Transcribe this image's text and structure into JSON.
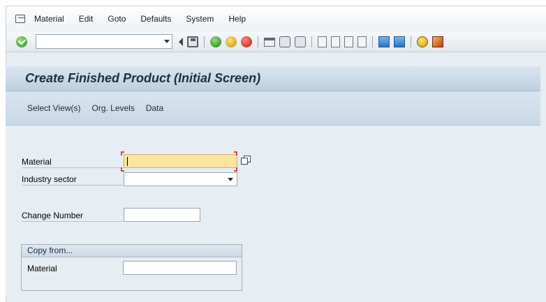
{
  "menubar": {
    "items": [
      {
        "label": "Material"
      },
      {
        "label": "Edit"
      },
      {
        "label": "Goto"
      },
      {
        "label": "Defaults"
      },
      {
        "label": "System"
      },
      {
        "label": "Help"
      }
    ]
  },
  "toolbar": {
    "command_value": "",
    "icons": [
      "enter-icon",
      "back-icon",
      "save-icon",
      "back-green-icon",
      "exit-icon",
      "cancel-icon",
      "print-icon",
      "find-icon",
      "find-next-icon",
      "first-page-icon",
      "previous-page-icon",
      "next-page-icon",
      "last-page-icon",
      "create-session-icon",
      "shortcut-icon",
      "help-icon",
      "layout-icon"
    ]
  },
  "screen": {
    "title": "Create Finished Product (Initial Screen)"
  },
  "app_toolbar": {
    "buttons": [
      {
        "label": "Select View(s)"
      },
      {
        "label": "Org. Levels"
      },
      {
        "label": "Data"
      }
    ]
  },
  "form": {
    "material_label": "Material",
    "material_value": "",
    "industry_sector_label": "Industry sector",
    "industry_sector_value": "",
    "change_number_label": "Change Number",
    "change_number_value": ""
  },
  "copy_from": {
    "header": "Copy from...",
    "material_label": "Material",
    "material_value": ""
  },
  "colors": {
    "required_field": "#fbe59c",
    "title_text": "#1c2f44",
    "background": "#e6edf3"
  }
}
